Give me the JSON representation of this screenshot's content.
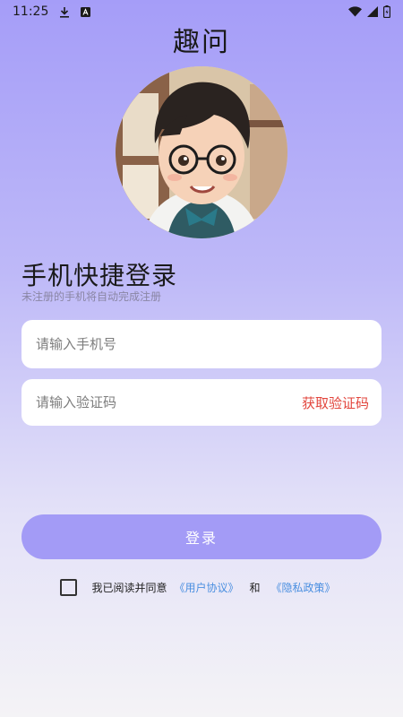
{
  "status_bar": {
    "time": "11:25",
    "icons": [
      "download-icon",
      "a-badge-icon",
      "wifi-icon",
      "signal-icon",
      "battery-icon"
    ]
  },
  "app": {
    "title": "趣问"
  },
  "avatar": {
    "icon": "avatar-illustration"
  },
  "login": {
    "title": "手机快捷登录",
    "subtitle": "未注册的手机将自动完成注册",
    "phone_placeholder": "请输入手机号",
    "code_placeholder": "请输入验证码",
    "get_code_label": "获取验证码",
    "submit_label": "登录"
  },
  "agreement": {
    "prefix": "我已阅读并同意",
    "user_agreement": "《用户协议》",
    "and": "和",
    "privacy_policy": "《隐私政策》",
    "checked": false
  },
  "colors": {
    "accent": "#a39bf6",
    "link": "#4a8fe0",
    "warning": "#e2453c"
  }
}
